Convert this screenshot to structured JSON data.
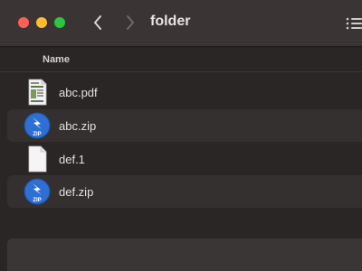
{
  "window": {
    "title": "folder"
  },
  "toolbar": {
    "back_icon": "chevron-left-icon",
    "forward_icon": "chevron-right-icon",
    "view_icon": "list-view-icon"
  },
  "list": {
    "column_name": "Name",
    "files": [
      {
        "name": "abc.pdf",
        "icon": "pdf-document-icon"
      },
      {
        "name": "abc.zip",
        "icon": "zip-archive-icon",
        "badge": "ZIP"
      },
      {
        "name": "def.1",
        "icon": "blank-document-icon"
      },
      {
        "name": "def.zip",
        "icon": "zip-archive-icon",
        "badge": "ZIP"
      }
    ]
  },
  "colors": {
    "close": "#fe5f57",
    "minimize": "#febc2e",
    "zoom": "#28c840",
    "zip_blue": "#2e6fd3"
  }
}
